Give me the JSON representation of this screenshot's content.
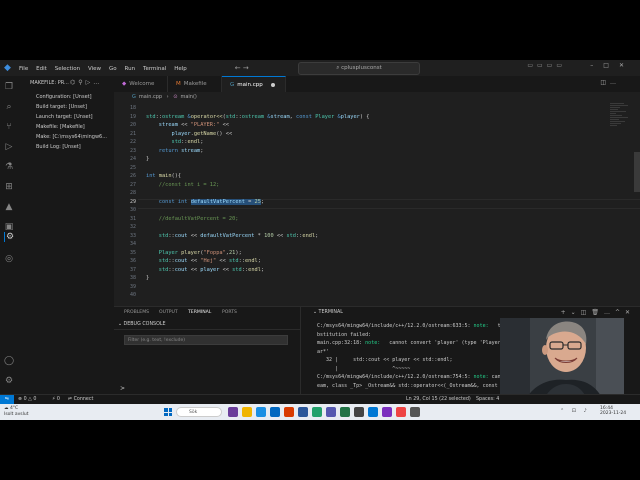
{
  "titlebar": {
    "menu": [
      "File",
      "Edit",
      "Selection",
      "View",
      "Go",
      "Run",
      "Terminal",
      "Help"
    ],
    "search": "cplusplusconst"
  },
  "sidepanel": {
    "header": "MAKEFILE: PR...",
    "items": [
      "Configuration: [Unset]",
      "Build target: [Unset]",
      "Launch target: [Unset]",
      "Makefile: [Makefile]",
      "Make: [C:\\msys64\\mingw6...",
      "Build Log: [Unset]"
    ]
  },
  "tabs": [
    {
      "label": "Welcome",
      "active": false
    },
    {
      "label": "Makefile",
      "active": false
    },
    {
      "label": "main.cpp",
      "active": true,
      "modified": true
    }
  ],
  "breadcrumb": {
    "file": "main.cpp",
    "symbol": "main()"
  },
  "editor": {
    "current_line": 29,
    "lines": [
      {
        "n": "18",
        "html": ""
      },
      {
        "n": "19",
        "html": "<span class='ty'>std</span>::<span class='ty'>ostream</span> <span class='kw'>&amp;</span><span class='fn'>operator&lt;&lt;</span>(<span class='ty'>std</span>::<span class='ty'>ostream</span> <span class='kw'>&amp;</span><span class='va'>stream</span>, <span class='kw'>const</span> <span class='ty'>Player</span> <span class='kw'>&amp;</span><span class='va'>player</span>) {"
      },
      {
        "n": "20",
        "html": "    <span class='va'>stream</span> &lt;&lt; <span class='st'>\"PLAYER:\"</span> &lt;&lt;"
      },
      {
        "n": "21",
        "html": "        <span class='va'>player</span>.<span class='fn'>getName</span>() &lt;&lt;"
      },
      {
        "n": "22",
        "html": "        <span class='ty'>std</span>::<span class='fn'>endl</span>;"
      },
      {
        "n": "23",
        "html": "    <span class='kw'>return</span> <span class='va'>stream</span>;"
      },
      {
        "n": "24",
        "html": "}"
      },
      {
        "n": "25",
        "html": ""
      },
      {
        "n": "26",
        "html": "<span class='kw'>int</span> <span class='fn'>main</span>(){"
      },
      {
        "n": "27",
        "html": "    <span class='cm'>//const int i = 12;</span>"
      },
      {
        "n": "28",
        "html": ""
      },
      {
        "n": "29",
        "html": "    <span class='kw'>const</span> <span class='kw'>int</span> <span class='sel'><span class='va'>defaultVatPercent</span> = <span class='nu'>25</span></span>;"
      },
      {
        "n": "30",
        "html": ""
      },
      {
        "n": "31",
        "html": "    <span class='cm'>//defaultVatPercent = 20;</span>"
      },
      {
        "n": "32",
        "html": ""
      },
      {
        "n": "33",
        "html": "    <span class='ty'>std</span>::<span class='va'>cout</span> &lt;&lt; <span class='va'>defaultVatPercent</span> * <span class='nu'>100</span> &lt;&lt; <span class='ty'>std</span>::<span class='fn'>endl</span>;"
      },
      {
        "n": "34",
        "html": ""
      },
      {
        "n": "35",
        "html": "    <span class='ty'>Player</span> <span class='fn'>player</span>(<span class='st'>\"Foppa\"</span>,<span class='nu'>21</span>);"
      },
      {
        "n": "36",
        "html": "    <span class='ty'>std</span>::<span class='va'>cout</span> &lt;&lt; <span class='st'>\"Hej\"</span> &lt;&lt; <span class='ty'>std</span>::<span class='fn'>endl</span>;"
      },
      {
        "n": "37",
        "html": "    <span class='ty'>std</span>::<span class='va'>cout</span> &lt;&lt; <span class='va'>player</span> &lt;&lt; <span class='ty'>std</span>::<span class='fn'>endl</span>;"
      },
      {
        "n": "38",
        "html": "}"
      },
      {
        "n": "39",
        "html": ""
      },
      {
        "n": "40",
        "html": ""
      }
    ]
  },
  "panel": {
    "tabs": [
      "PROBLEMS",
      "OUTPUT",
      "TERMINAL",
      "PORTS"
    ],
    "active_tab": "TERMINAL",
    "debug_header": "DEBUG CONSOLE",
    "filter_placeholder": "Filter (e.g. text, !exclude)",
    "prompt": ">"
  },
  "terminal": {
    "header": "TERMINAL",
    "lines": [
      {
        "html": "C:/msys64/mingw64/include/c++/12.2.0/ostream:633:5: <span class='note'>note:</span>   template argum"
      },
      {
        "html": "bstitution failed:"
      },
      {
        "html": "main.cpp:32:18: <span class='note'>note:</span>   cannot convert 'player' (type 'Player') to type"
      },
      {
        "html": "ar*'"
      },
      {
        "html": "   32 |     std::cout &lt;&lt; player &lt;&lt; std::endl;"
      },
      {
        "html": "      |                  ^~~~~~"
      },
      {
        "html": "C:/msys64/mingw64/include/c++/12.2.0/ostream:754:5: <span class='note'>note:</span> candidat"
      },
      {
        "html": "eam, class _Tp&gt; _Ostream&amp;&amp; std::operator&lt;&lt;(_Ostream&amp;&amp;, const"
      }
    ]
  },
  "statusbar": {
    "problems": "0",
    "warnings": "0",
    "ports": "0",
    "connect": "Connect",
    "position": "Ln 29, Col 15 (22 selected)",
    "spaces": "Spaces: 4"
  },
  "taskbar": {
    "weather_temp": "4°C",
    "weather_desc": "Isolt avslut",
    "search": "Sök",
    "time": "16:44",
    "date": "2023-11-24"
  }
}
